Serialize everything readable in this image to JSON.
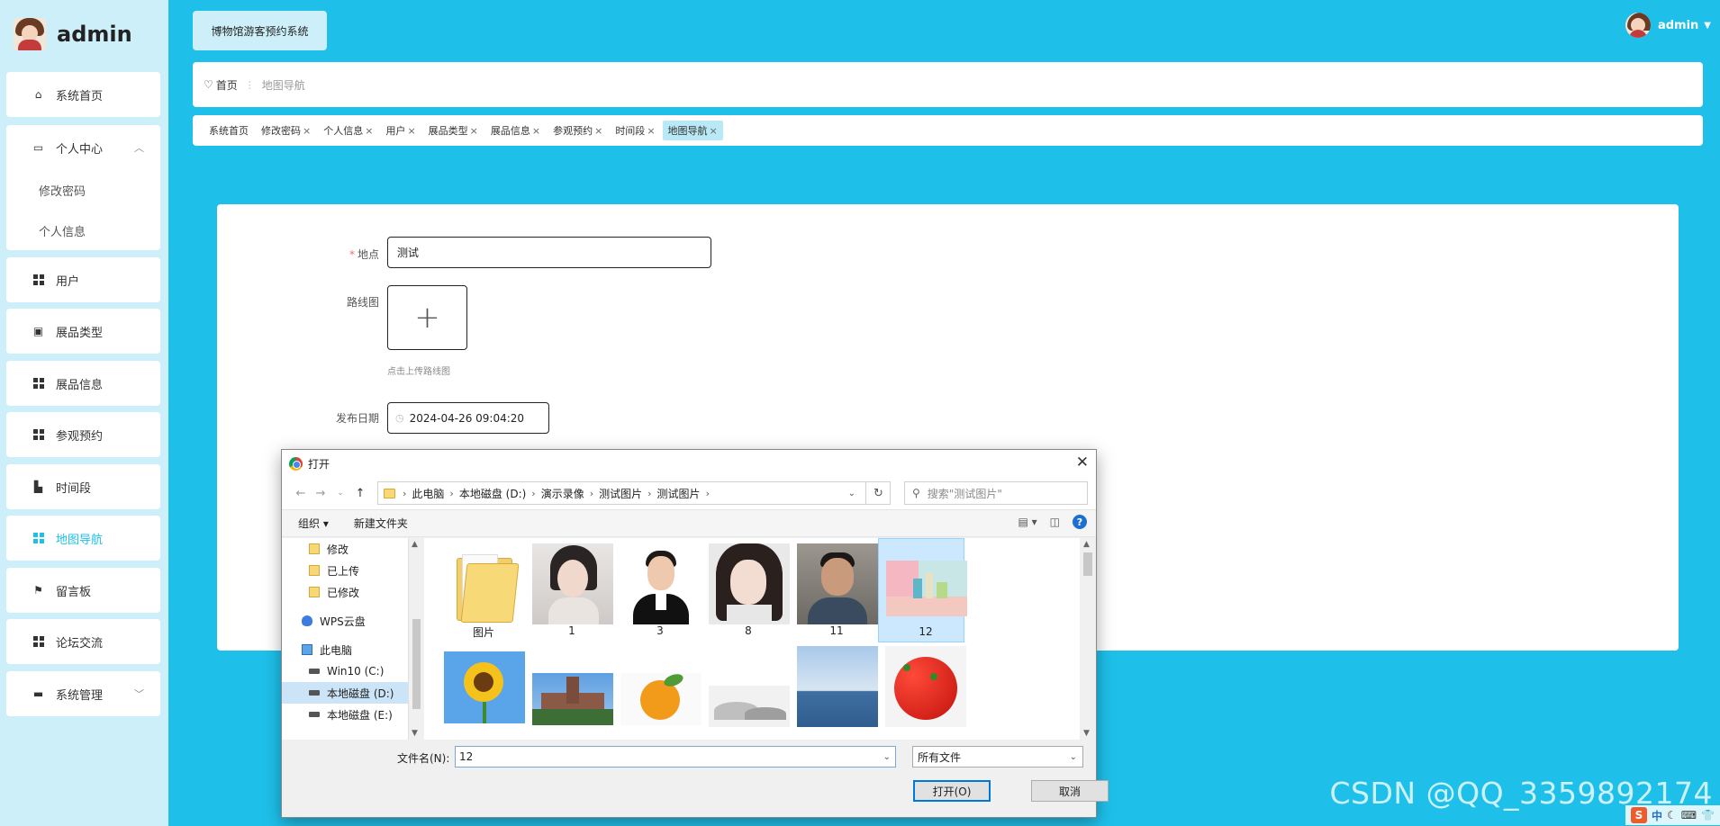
{
  "sidebar": {
    "brand": "admin",
    "items": [
      {
        "label": "系统首页",
        "icon": "home-icon"
      },
      {
        "label": "个人中心",
        "icon": "profile-icon"
      },
      {
        "label": "修改密码"
      },
      {
        "label": "个人信息"
      },
      {
        "label": "用户",
        "icon": "grid-icon"
      },
      {
        "label": "展品类型",
        "icon": "clipboard-icon"
      },
      {
        "label": "展品信息",
        "icon": "grid-icon"
      },
      {
        "label": "参观预约",
        "icon": "grid-icon"
      },
      {
        "label": "时间段",
        "icon": "calendar-icon"
      },
      {
        "label": "地图导航",
        "icon": "grid-icon",
        "active": true
      },
      {
        "label": "留言板",
        "icon": "flag-icon"
      },
      {
        "label": "论坛交流",
        "icon": "grid-icon"
      },
      {
        "label": "系统管理",
        "icon": "briefcase-icon"
      }
    ]
  },
  "header": {
    "system_title": "博物馆游客预约系统",
    "user": "admin"
  },
  "breadcrumb": {
    "home": "首页",
    "current": "地图导航"
  },
  "tags": [
    {
      "label": "系统首页",
      "closable": false
    },
    {
      "label": "修改密码",
      "closable": true
    },
    {
      "label": "个人信息",
      "closable": true
    },
    {
      "label": "用户",
      "closable": true
    },
    {
      "label": "展品类型",
      "closable": true
    },
    {
      "label": "展品信息",
      "closable": true
    },
    {
      "label": "参观预约",
      "closable": true
    },
    {
      "label": "时间段",
      "closable": true
    },
    {
      "label": "地图导航",
      "closable": true,
      "active": true
    }
  ],
  "close_glyph": "×",
  "form": {
    "place_label": "地点",
    "place_value": "测试",
    "route_label": "路线图",
    "upload_plus": "+",
    "upload_tip": "点击上传路线图",
    "date_label": "发布日期",
    "date_value": "2024-04-26 09:04:20"
  },
  "dialog": {
    "title": "打开",
    "path": [
      "此电脑",
      "本地磁盘 (D:)",
      "演示录像",
      "测试图片",
      "测试图片"
    ],
    "search_placeholder": "搜索\"测试图片\"",
    "toolbar": {
      "organize": "组织 ▾",
      "new_folder": "新建文件夹"
    },
    "nav_items": [
      {
        "label": "修改",
        "type": "folder"
      },
      {
        "label": "已上传",
        "type": "folder"
      },
      {
        "label": "已修改",
        "type": "folder"
      },
      {
        "label": "WPS云盘",
        "type": "cloud"
      },
      {
        "label": "此电脑",
        "type": "pc"
      },
      {
        "label": "Win10 (C:)",
        "type": "drive"
      },
      {
        "label": "本地磁盘 (D:)",
        "type": "drive",
        "selected": true
      },
      {
        "label": "本地磁盘 (E:)",
        "type": "drive"
      }
    ],
    "files": [
      {
        "name": "图片",
        "kind": "folder"
      },
      {
        "name": "1",
        "kind": "photo-portrait-girl"
      },
      {
        "name": "3",
        "kind": "photo-portrait-man"
      },
      {
        "name": "8",
        "kind": "photo-portrait-girl2"
      },
      {
        "name": "11",
        "kind": "photo-portrait-man2"
      },
      {
        "name": "12",
        "kind": "photo-pastel",
        "selected": true
      },
      {
        "name": "",
        "kind": "photo-sunflower"
      },
      {
        "name": "",
        "kind": "photo-building"
      },
      {
        "name": "",
        "kind": "photo-orange"
      },
      {
        "name": "",
        "kind": "photo-landscape"
      },
      {
        "name": "",
        "kind": "photo-sea"
      },
      {
        "name": "",
        "kind": "photo-strawberry"
      }
    ],
    "filename_label": "文件名(N):",
    "filename_value": "12",
    "filetype": "所有文件",
    "open_button": "打开(O)",
    "cancel_button": "取消"
  },
  "watermark": "CSDN @QQ_3359892174",
  "ime": {
    "logo": "S",
    "text": "中"
  }
}
